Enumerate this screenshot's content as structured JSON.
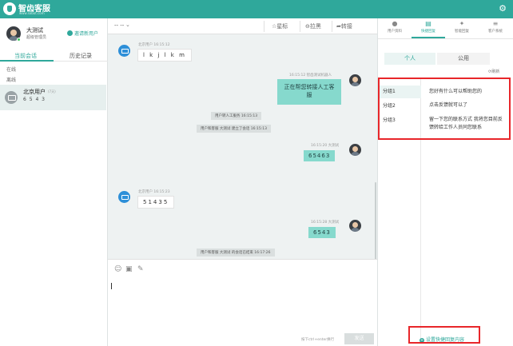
{
  "app": {
    "title": "智齿客服",
    "subtitle": "www.sobot.com",
    "settings_icon": "gear-icon"
  },
  "agent": {
    "name": "大测试",
    "role": "超级管理员",
    "invite_label": "邀请新用户"
  },
  "left_tabs": [
    "当前会话",
    "历史记录"
  ],
  "groups": {
    "online": "在线",
    "offline": "离线"
  },
  "contact": {
    "name": "北京用户",
    "tag": "(7天)",
    "last_msg": "6 5 4 3"
  },
  "chat_header": {
    "title": "-- --",
    "actions": [
      "星标",
      "拉黑",
      "转接"
    ]
  },
  "messages": [
    {
      "side": "left",
      "meta": "北京用户 16:15:12",
      "text": "l k j l k m"
    },
    {
      "side": "right",
      "meta": "16:15:12 智齿测试机器人",
      "text": "正在帮您转接人工客服"
    },
    {
      "side": "system",
      "text": "用户转人工服务 16:15:13"
    },
    {
      "side": "system",
      "text": "用户和客服 大测试 建立了会话 16:15:13"
    },
    {
      "side": "right",
      "meta": "16:15:20 大测试",
      "text": "65463"
    },
    {
      "side": "left",
      "meta": "北京用户 16:15:23",
      "text": "51435"
    },
    {
      "side": "right",
      "meta": "16:15:28 大测试",
      "text": "6543"
    },
    {
      "side": "system",
      "text": "用户和客服 大测试 的会话已结束 16:17:26"
    }
  ],
  "composer": {
    "hint": "按下ctrl+enter换行",
    "send_label": "发送"
  },
  "right_tabs": [
    "用户资料",
    "快捷回复",
    "智能回复",
    "客户系统"
  ],
  "reply_scope": {
    "personal": "个人",
    "public": "公用"
  },
  "refresh_label": "刷新",
  "reply_groups": [
    "分组1",
    "分组2",
    "分组3"
  ],
  "phrases": [
    "您好有什么可以帮助您的",
    "点击反馈就可以了",
    "留一下您的联系方式 我将您目前反馈转给工作人员同您联系"
  ],
  "set_phrases_label": "设置快捷回复内容",
  "colors": {
    "brand": "#2fa89b",
    "highlight": "#e8262a",
    "bubble": "#86d9cd"
  }
}
